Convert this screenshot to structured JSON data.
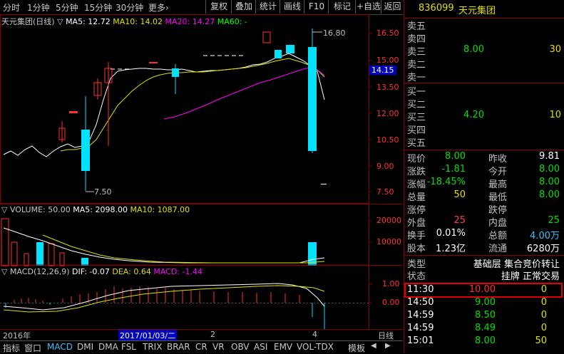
{
  "top_tabs": [
    "分时",
    "1分钟",
    "5分钟",
    "15分钟",
    "30分钟",
    "更多›"
  ],
  "top_buttons": [
    "复权",
    "叠加",
    "统计",
    "画线",
    "F10",
    "标记",
    "+自选",
    "返回"
  ],
  "main_legend": {
    "title": "天元集团(日线)",
    "ma5": "MA5: 12.72",
    "ma10": "MA10: 14.02",
    "ma20": "MA20: 14.27",
    "ma60": "MA60: -"
  },
  "price_axis": [
    "16.50",
    "15.00",
    "13.50",
    "12.00",
    "10.50",
    "9.00",
    "7.50"
  ],
  "current_price_tag": "14.15",
  "high_marker": "16.80",
  "low_marker": "7.50",
  "vol_legend": {
    "label": "VOLUME: 50.00",
    "ma5": "MA5: 2098.00",
    "ma10": "MA10: 1087.00"
  },
  "vol_axis": [
    "20000",
    "10000"
  ],
  "macd_legend": {
    "label": "MACD(12,26,9)",
    "dif": "DIF: -0.07",
    "dea": "DEA: 0.64",
    "macd": "MACD: -1.44"
  },
  "macd_axis": [
    "1.00",
    "0.00"
  ],
  "date_bar": {
    "year": "2016年",
    "cursor_date": "2017/01/03/二",
    "m2": "2",
    "m4": "4",
    "right": "日线"
  },
  "bottom_tabs": [
    "指标",
    "窗口",
    "MACD",
    "DMI",
    "DMA",
    "FSL",
    "TRIX",
    "BRAR",
    "CR",
    "VR",
    "OBV",
    "ASI",
    "EMV",
    "VOL-TDX",
    "模板"
  ],
  "stock": {
    "code": "836099",
    "name": "天元集团"
  },
  "asks": [
    {
      "label": "卖五",
      "price": "",
      "vol": ""
    },
    {
      "label": "卖四",
      "price": "",
      "vol": ""
    },
    {
      "label": "卖三",
      "price": "8.00",
      "vol": "30"
    },
    {
      "label": "卖二",
      "price": "",
      "vol": ""
    },
    {
      "label": "卖一",
      "price": "",
      "vol": ""
    }
  ],
  "bids": [
    {
      "label": "买一",
      "price": "",
      "vol": ""
    },
    {
      "label": "买二",
      "price": "",
      "vol": ""
    },
    {
      "label": "买三",
      "price": "4.20",
      "vol": "10"
    },
    {
      "label": "买四",
      "price": "",
      "vol": ""
    },
    {
      "label": "买五",
      "price": "",
      "vol": ""
    }
  ],
  "quote": [
    {
      "l1": "现价",
      "v1": "8.00",
      "c1": "#00e000",
      "l2": "昨收",
      "v2": "9.81",
      "c2": "#ffffff"
    },
    {
      "l1": "涨跌",
      "v1": "-1.81",
      "c1": "#00e000",
      "l2": "今开",
      "v2": "8.00",
      "c2": "#00e000"
    },
    {
      "l1": "涨幅",
      "v1": "-18.45%",
      "c1": "#00e000",
      "l2": "最高",
      "v2": "8.00",
      "c2": "#00e000"
    },
    {
      "l1": "总量",
      "v1": "50",
      "c1": "#e0e000",
      "l2": "最低",
      "v2": "8.00",
      "c2": "#00e000"
    },
    {
      "l1": "涨停",
      "v1": "",
      "c1": "#ff4040",
      "l2": "跌停",
      "v2": "",
      "c2": "#00e000"
    },
    {
      "l1": "外盘",
      "v1": "25",
      "c1": "#ff4040",
      "l2": "内盘",
      "v2": "25",
      "c2": "#00e000"
    },
    {
      "l1": "换手",
      "v1": "0.01%",
      "c1": "#ffffff",
      "l2": "总额",
      "v2": "4.00万",
      "c2": "#40c0ff"
    },
    {
      "l1": "股本",
      "v1": "1.23亿",
      "c1": "#ffffff",
      "l2": "流通",
      "v2": "6280万",
      "c2": "#ffffff"
    }
  ],
  "info": [
    {
      "l": "类型",
      "v": "基础层 集合竞价转让"
    },
    {
      "l": "状态",
      "v": "挂牌 正常交易"
    }
  ],
  "trades": [
    {
      "time": "11:30",
      "price": "10.00",
      "pc": "#ff3030",
      "vol": "0"
    },
    {
      "time": "14:50",
      "price": "9.00",
      "pc": "#00e000",
      "vol": "0"
    },
    {
      "time": "14:59",
      "price": "8.50",
      "pc": "#00e000",
      "vol": "0"
    },
    {
      "time": "14:59",
      "price": "8.49",
      "pc": "#00e000",
      "vol": "0"
    },
    {
      "time": "15:01",
      "price": "8.00",
      "pc": "#00e000",
      "vol": "50"
    }
  ],
  "colors": {
    "up": "#ff3030",
    "down": "#00e0ff",
    "ma5": "#ffffff",
    "ma10": "#e0e000",
    "ma20": "#ff00ff",
    "ma60": "#00ff00",
    "panel_border": "#800000"
  }
}
